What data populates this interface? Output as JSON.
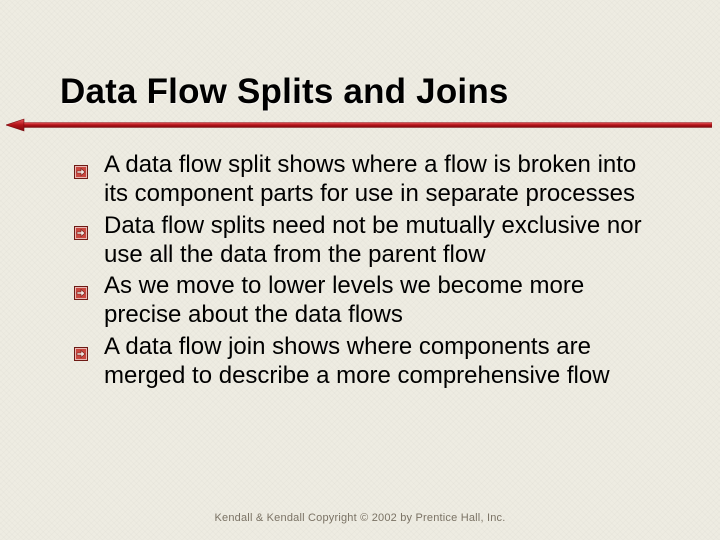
{
  "slide": {
    "title": "Data Flow Splits and Joins",
    "bullets": [
      "A data flow split shows where a flow is broken into its component parts for use in separate processes",
      "Data flow splits need not be mutually exclusive nor use all the data from the parent flow",
      "As we move to lower levels we become more precise about the data flows",
      "A data flow join shows where components are merged to describe a more comprehensive flow"
    ],
    "footer": "Kendall & Kendall  Copyright © 2002 by Prentice Hall, Inc."
  },
  "colors": {
    "accent": "#b31217"
  }
}
